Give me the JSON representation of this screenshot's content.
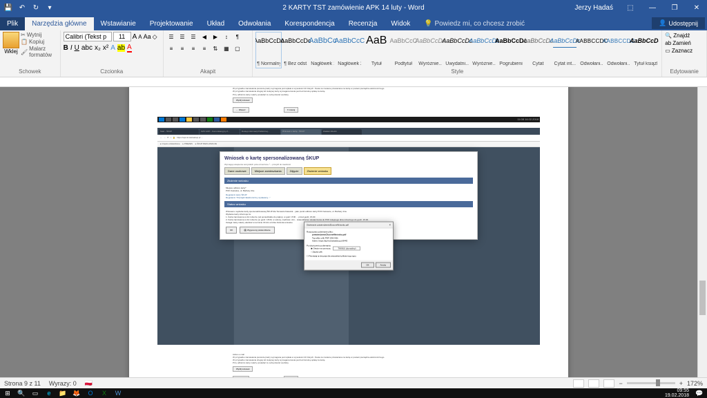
{
  "titlebar": {
    "title": "2 KARTY TST zamówienie APK 14 luty  -  Word",
    "user": "Jerzy Hadaś"
  },
  "tabs": {
    "plik": "Plik",
    "home": "Narzędzia główne",
    "insert": "Wstawianie",
    "design": "Projektowanie",
    "layout": "Układ",
    "refs": "Odwołania",
    "mail": "Korespondencja",
    "review": "Recenzja",
    "view": "Widok",
    "tell": "Powiedz mi, co chcesz zrobić",
    "share": "Udostępnij"
  },
  "ribbon": {
    "clipboard": {
      "label": "Schowek",
      "paste": "Wklej",
      "cut": "Wytnij",
      "copy": "Kopiuj",
      "painter": "Malarz formatów"
    },
    "font": {
      "label": "Czcionka",
      "family": "Calibri (Tekst p",
      "size": "11"
    },
    "para": {
      "label": "Akapit"
    },
    "styles": {
      "label": "Style",
      "items": [
        {
          "preview": "AaBbCcDc",
          "name": "¶ Normalny",
          "css": "font-size:9px"
        },
        {
          "preview": "AaBbCcDc",
          "name": "¶ Bez odst...",
          "css": "font-size:9px"
        },
        {
          "preview": "AaBbCc",
          "name": "Nagłówek 1",
          "css": "color:#2e74b5;font-size:11px"
        },
        {
          "preview": "AaBbCcC",
          "name": "Nagłówek 2",
          "css": "color:#2e74b5;font-size:10px"
        },
        {
          "preview": "AaB",
          "name": "Tytuł",
          "css": "font-size:16px"
        },
        {
          "preview": "AaBbCcC",
          "name": "Podtytuł",
          "css": "color:#888;font-size:9px"
        },
        {
          "preview": "AaBbCcDc",
          "name": "Wyróżnie...",
          "css": "font-style:italic;color:#888;font-size:9px"
        },
        {
          "preview": "AaBbCcDc",
          "name": "Uwydatni...",
          "css": "font-style:italic;font-size:9px"
        },
        {
          "preview": "AaBbCcDc",
          "name": "Wyróżnie...",
          "css": "font-style:italic;color:#2e74b5;font-size:9px"
        },
        {
          "preview": "AaBbCcDc",
          "name": "Pogrubienie",
          "css": "font-weight:bold;font-size:9px"
        },
        {
          "preview": "AaBbCcDc",
          "name": "Cytat",
          "css": "font-style:italic;color:#666;font-size:9px"
        },
        {
          "preview": "AaBbCcDc",
          "name": "Cytat int...",
          "css": "font-style:italic;color:#2e74b5;font-size:9px;border-bottom:1px solid #2e74b5"
        },
        {
          "preview": "AABBCCDC",
          "name": "Odwołani...",
          "css": "font-size:8px;letter-spacing:.3px"
        },
        {
          "preview": "AABBCCDC",
          "name": "Odwołani...",
          "css": "font-size:8px;color:#2e74b5;letter-spacing:.3px"
        },
        {
          "preview": "AaBbCcDc",
          "name": "Tytuł książki",
          "css": "font-style:italic;font-weight:bold;font-size:9px"
        }
      ]
    },
    "editing": {
      "label": "Edytowanie",
      "find": "Znajdź",
      "replace": "Zamień",
      "select": "Zaznacz"
    }
  },
  "doc": {
    "modal_title": "Wniosek o kartę spersonalizowaną ŚKUP",
    "modal_sub": "Wymagaj ustapienia wszystkich pola oznaczone * – przejdź do zawilości",
    "steps": [
      "Dane osobowe",
      "Miejsce zamieszkania",
      "Zdjęcie",
      "Złożenie wniosku"
    ],
    "section1": "Złożenie wniosku",
    "section2": "Status wniosku",
    "q1": "Miejsce odbioru karty*",
    "a1": "POK Katowice, ul. Barbary 21a",
    "link1": "Regulamin karty ŚKUP",
    "link2": "Regulamin \"Pieniądz Elektroniczny wydawany...\"",
    "body1": "Wniosek o wydanie karty spersonalizowanej ŚKUP dla Tomasza Fatowsk... jako punkt odbioru karty POK Katowice, ul. Barbary 21a.",
    "body2": "Wydanie karty informuje że:",
    "body3": "1. Karta zamówiona w dni robocze (od poniedziałku do piątku), w godz. 8:00 ... przed godz. 15.00",
    "body4": "2. Karta zamówiona w dni robocze po godz. 18:00, w soboty, niedziele i dni... stwierdzania i dostarczenia do POK kolejnego dnia roboczego do godz. 15.00.",
    "body5": "Uwaga: karty należy odebrać w terminie 30 dni od dnia złożenia wniosku.",
    "btn_ok": "OK",
    "btn_gen": "Wygeneruj potwierdzenie",
    "dialog_title": "Otwieranie potwierdzenieZlozoneWniosku.pdf",
    "dialog_l1": "Rozpoczęto pobieranie pliku:",
    "dialog_file": "potwierdzenieZlozoneWniosku.pdf",
    "dialog_type": "Typ pliku: plik PDF (392 KB)",
    "dialog_addr": "Adres: https://api-tst.kartaskup.pl:8443",
    "dialog_q": "Po ukończeniu pobierania:",
    "dialog_opt1": "Otwórz za pomocą",
    "dialog_sel": "TWINUI (domyślny)",
    "dialog_opt2": "Zapisz plik",
    "dialog_chk": "Pamiętaj tę decyzję dla wszystkich plików tego typu",
    "dialog_ok": "OK",
    "dialog_cancel": "Anuluj",
    "info1": "Adres e-mail",
    "info2": "W przypadku zamawiania pierwszej karty wymagana jest wpłata w wysokości 20 złotych. Kwota ta zostanie przekazana na kartę w postaci pieniądza elektronicznego.",
    "info3": "W przypadku zamawiania drugiej lub kolejnej karty wymagana kwota jest bezzwrotną opłatą za kartę.",
    "info4": "Przy odbiorze karty należy posiadać ze sobą dowód osobisty.",
    "btn_send": "Wyślij wniosek",
    "btn_back": "← Wstecz",
    "btn_cancel2": "✕ Anuluj",
    "url": "https://api-tst.kartaskup.pl ...",
    "chrome_tabs": [
      "Start - ŚKUP",
      "KZK GOP - Komunikacyjny Z...",
      "Dostęp informacji Publicznej...",
      "Wniosek o kartę - ŚKUP",
      "Zasiłek Ubezki"
    ],
    "bookmarks": [
      "Często odwiedzane",
      "PREZES",
      "ŚKUP REKLAMACJE"
    ]
  },
  "statusbar": {
    "page": "Strona 9 z 11",
    "words": "Wyrazy: 0",
    "zoom": "172%"
  },
  "taskbar": {
    "time": "09:55",
    "date": "19.02.2018"
  }
}
